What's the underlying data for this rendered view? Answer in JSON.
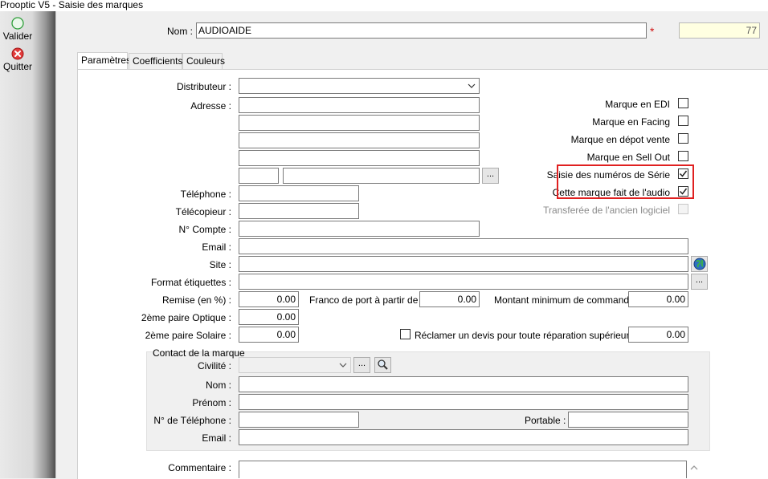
{
  "window": {
    "title": "Prooptic V5 - Saisie des marques"
  },
  "toolbar": {
    "validate_label": "Valider",
    "quit_label": "Quitter"
  },
  "header": {
    "name_label": "Nom :",
    "name_value": "AUDIOAIDE",
    "required_mark": "*",
    "id_value": "77"
  },
  "tabs": [
    {
      "label": "Paramètres",
      "active": true
    },
    {
      "label": "Coefficients"
    },
    {
      "label": "Couleurs"
    }
  ],
  "fields": {
    "distributeur_label": "Distributeur :",
    "adresse_label": "Adresse :",
    "telephone_label": "Téléphone :",
    "telecopieur_label": "Télécopieur :",
    "compte_label": "N° Compte :",
    "email_label": "Email :",
    "site_label": "Site :",
    "format_label": "Format étiquettes :",
    "remise_label": "Remise (en %) :",
    "remise_value": "0.00",
    "franco_label": "Franco de port à partir de  :",
    "franco_value": "0.00",
    "montant_label": "Montant minimum de commande :",
    "montant_value": "0.00",
    "optique_label": "2ème paire Optique :",
    "optique_value": "0.00",
    "solaire_label": "2ème paire Solaire :",
    "solaire_value": "0.00",
    "devis_label": "Réclamer un devis pour toute réparation supérieure à :",
    "devis_value": "0.00",
    "ellipsis": "..."
  },
  "checkboxes": {
    "edi_label": "Marque en EDI",
    "facing_label": "Marque en Facing",
    "depot_label": "Marque en dépot vente",
    "sellout_label": "Marque en Sell Out",
    "serie_label": "Saisie des numéros de Série",
    "audio_label": "Cette marque fait de l'audio",
    "transfer_label": "Transferée de l'ancien logiciel"
  },
  "contact": {
    "group_label": "Contact de la marque",
    "civilite_label": "Civilité :",
    "nom_label": "Nom :",
    "prenom_label": "Prénom :",
    "tel_label": "N° de Téléphone :",
    "portable_label": "Portable :",
    "email_label": "Email :"
  },
  "comment": {
    "label": "Commentaire :"
  },
  "colors": {
    "highlight": "#e02020",
    "id_field_bg": "#ffffe1"
  }
}
